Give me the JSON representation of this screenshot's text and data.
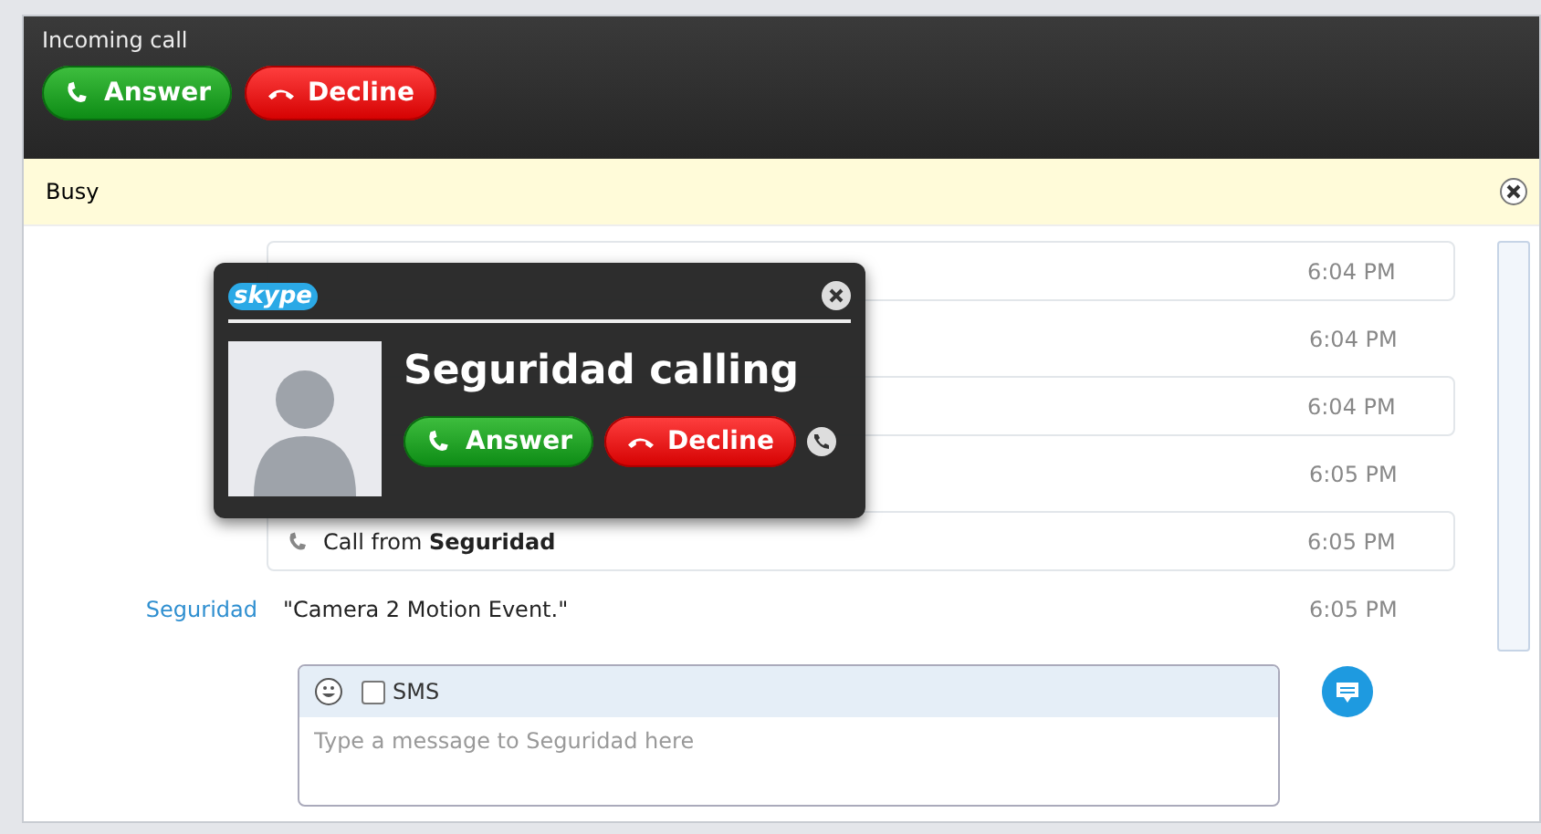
{
  "incoming_bar": {
    "title": "Incoming call",
    "buttons": [
      {
        "kind": "answer",
        "label": "Answer"
      },
      {
        "kind": "decline",
        "label": "Decline"
      }
    ]
  },
  "status_notice": {
    "text": "Busy"
  },
  "conversation": [
    {
      "kind": "call",
      "time": "6:04 PM"
    },
    {
      "kind": "message",
      "time": "6:04 PM"
    },
    {
      "kind": "call",
      "time": "6:04 PM"
    },
    {
      "kind": "message",
      "time": "6:05 PM"
    },
    {
      "kind": "call",
      "text": "Call from **Seguridad**",
      "time": "6:05 PM"
    },
    {
      "kind": "message",
      "sender": "Seguridad",
      "text": "\"Camera 2 Motion Event.\"",
      "time": "6:05 PM"
    }
  ],
  "composer": {
    "sms": {
      "label": "SMS",
      "checked": false
    },
    "placeholder": "Type a message to Seguridad here"
  },
  "call_popup": {
    "logo": "skype",
    "title": "Seguridad calling",
    "buttons": [
      {
        "kind": "answer",
        "label": "Answer"
      },
      {
        "kind": "decline",
        "label": "Decline"
      }
    ]
  }
}
